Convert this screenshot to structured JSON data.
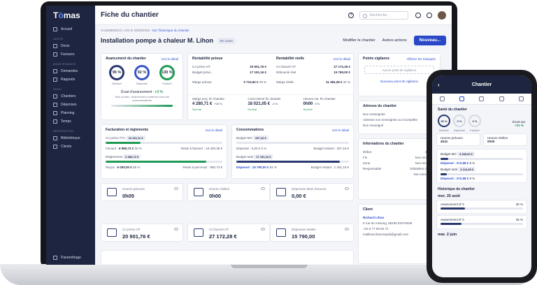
{
  "app": {
    "logo_pre": "T",
    "logo_mid": "ö",
    "logo_post": "mas",
    "page_title": "Fiche du chantier"
  },
  "topbar": {
    "search_placeholder": "Recherche...",
    "help_icon": "?"
  },
  "sidebar": {
    "items": [
      {
        "label": "Accueil",
        "icon": "home-icon"
      },
      {
        "group": "VENTE"
      },
      {
        "label": "Devis",
        "icon": "document-icon"
      },
      {
        "label": "Factures",
        "icon": "invoice-icon"
      },
      {
        "group": "MAINTENANCE"
      },
      {
        "label": "Demandes",
        "icon": "wrench-icon"
      },
      {
        "label": "Rapports",
        "icon": "report-icon"
      },
      {
        "group": "SUIVI"
      },
      {
        "label": "Chantiers",
        "icon": "building-icon"
      },
      {
        "label": "Dépenses",
        "icon": "wallet-icon"
      },
      {
        "label": "Planning",
        "icon": "calendar-icon"
      },
      {
        "label": "Temps",
        "icon": "clock-icon"
      },
      {
        "group": "RÉFÉRENTIEL"
      },
      {
        "label": "Bibliothèque",
        "icon": "book-icon"
      },
      {
        "label": "Clients",
        "icon": "users-icon"
      }
    ],
    "bottom": "Paramétrage"
  },
  "header": {
    "crumb_id": "CH260800023",
    "crumb_created": "créé le 20/08/2026",
    "crumb_link": "Voir l'historique du chantier",
    "title": "Installation pompe à chaleur M. Lihon",
    "status": "En cours",
    "edit": "Modifier le chantier",
    "other": "Autres actions",
    "new": "Nouveau..."
  },
  "progress": {
    "title": "Avancement du chantier",
    "more": "Voir le détail",
    "rings": [
      {
        "value": "95 %",
        "label": "Déclaré",
        "color": "#2a3870"
      },
      {
        "value": "92 %",
        "label": "Dépensé",
        "color": "#3a55c8"
      },
      {
        "value": "130 %",
        "label": "Facturé",
        "color": "#1f9a55"
      }
    ],
    "gap_label": "Écart d'avancement :",
    "gap_value": "+3 %",
    "gap_note": "Tout va bien, avancement cohérent avec les consommations"
  },
  "rentab": {
    "prev_title": "Rentabilité prévue",
    "prev_rows": [
      [
        "CA prévu HT",
        "20 901,76 €"
      ],
      [
        "Budget prévu",
        "17 191,16 €"
      ]
    ],
    "prev_margin_label": "Marge prévue",
    "prev_margin": "3 710,60 €",
    "prev_pct": "18 %",
    "real_title": "Rentabilité réelle",
    "real_more": "Voir le détail",
    "real_rows": [
      [
        "CA facturé HT",
        "27 172,28 €"
      ],
      [
        "Déboursé réel",
        "15 790,00 €"
      ]
    ],
    "real_margin_label": "Marge réelle",
    "real_margin": "11 382,28 €",
    "real_pct": "42 %",
    "proj": [
      {
        "label": "Marge proj. fin chantier",
        "value": "4 280,71 €",
        "delta": "+15 %"
      },
      {
        "label": "Coût estimé fin chantier",
        "value": "18 021,05 €",
        "delta": "-3 %"
      },
      {
        "label": "Heures est. fin chantier",
        "value": "0h00",
        "delta": "0 %"
      }
    ],
    "normal": "Normal"
  },
  "vigilance": {
    "title": "Points vigilance",
    "count": "0",
    "show": "Afficher les masqués",
    "empty": "Aucun point de vigilance",
    "add": "Nouveau point de vigilance"
  },
  "address": {
    "title": "Adresse du chantier",
    "lines": [
      "Non renseignée",
      "Adresse non renseignée ou incomplète",
      "Non renseigné"
    ]
  },
  "info": {
    "title": "Informations du chantier",
    "more": "Modif",
    "rows": [
      [
        "Début",
        "20 août"
      ],
      [
        "Fin",
        "Non renseigné"
      ],
      [
        "Zone",
        "Non renseigné"
      ],
      [
        "Responsable",
        "Sébastien CHABE"
      ],
      [
        "",
        "Non renseignés"
      ]
    ]
  },
  "client": {
    "title": "Client",
    "name": "Richard Lihon",
    "addr": "5 rue du rossong, 68190 ENTHEIM",
    "phone": "+33 6 77 59 83 72",
    "mail": "mailleuschanompub@gmail.com"
  },
  "billing": {
    "title": "Facturation et règlements",
    "more": "Voir le détail",
    "ca_label": "CA prévu TTC",
    "ca_chip": "22 261,11 €",
    "fact_label": "Facturé :",
    "fact_value": "6 980,73 €",
    "fact_pct": "30 %",
    "fact_rest": "Reste à facturer : 16 400,38 €",
    "reg_label": "Règlements",
    "reg_chip": "6 980,72 €",
    "recu_label": "Reçus :",
    "recu_value": "6 000,00 €",
    "recu_pct": "86 %",
    "recu_rest": "Reste à percevoir : 980,73 €"
  },
  "consumption": {
    "title": "Consommations",
    "more": "Voir le détail",
    "mo_label": "Budget MO",
    "mo_chip": "257,16 €",
    "mo_spent": "Dépensé : 0,00 €",
    "mo_pct": "0 %",
    "mo_rest": "Budget restant : 257,16 €",
    "tot_label": "Budget total",
    "tot_chip": "17 191,16 €",
    "tot_spent": "Dépensé : 15 790,00 €",
    "tot_pct": "92 %",
    "tot_rest": "Budget restant : 1 401,16 €"
  },
  "kpis": [
    {
      "label": "Heures prévues",
      "value": "0h05",
      "icon": "clipboard-icon"
    },
    {
      "label": "Heures réelles",
      "value": "0h00",
      "icon": "checklist-icon"
    },
    {
      "label": "Dépenses Main d'oeuvre",
      "value": "0,00 €",
      "icon": "hours-icon"
    },
    {
      "label": "CA prévu HT",
      "value": "20 901,76 €",
      "icon": "money-icon"
    },
    {
      "label": "CA facturé HT",
      "value": "27 172,28 €",
      "icon": "cash-icon"
    },
    {
      "label": "Dépenses totales",
      "value": "15 790,00",
      "icon": "expenses-icon"
    }
  ],
  "phone": {
    "title": "Chantier",
    "health": "Santé du chantier",
    "rings": [
      {
        "value": "90 %",
        "label": "Déclaré"
      },
      {
        "value": "0 %",
        "label": "Dépensé"
      },
      {
        "value": "0 %",
        "label": "Facturé"
      }
    ],
    "gap_label": "Écart avt.",
    "gap_value": "+22 %",
    "h_prev_label": "Heures prévues",
    "h_prev": "4h41",
    "h_real_label": "Heures réelles",
    "h_real": "0h05",
    "mo_label": "Budget MO",
    "mo_chip": "3 090,00 €",
    "mo_spent": "Dépensé : 272,98 €",
    "mo_pct": "9 %",
    "tot_label": "Budget total",
    "tot_chip": "3 214,99 €",
    "tot_spent": "Dépensé : 272,98 €",
    "tot_pct": "8 %",
    "hist_title": "Historique du chantier",
    "date1": "mer. 25 août",
    "entries": [
      {
        "label": "Avancement N°4",
        "pct": "30 %"
      },
      {
        "label": "Avancement N°3",
        "pct": "25 %"
      }
    ],
    "date2": "mar. 2 juin"
  }
}
